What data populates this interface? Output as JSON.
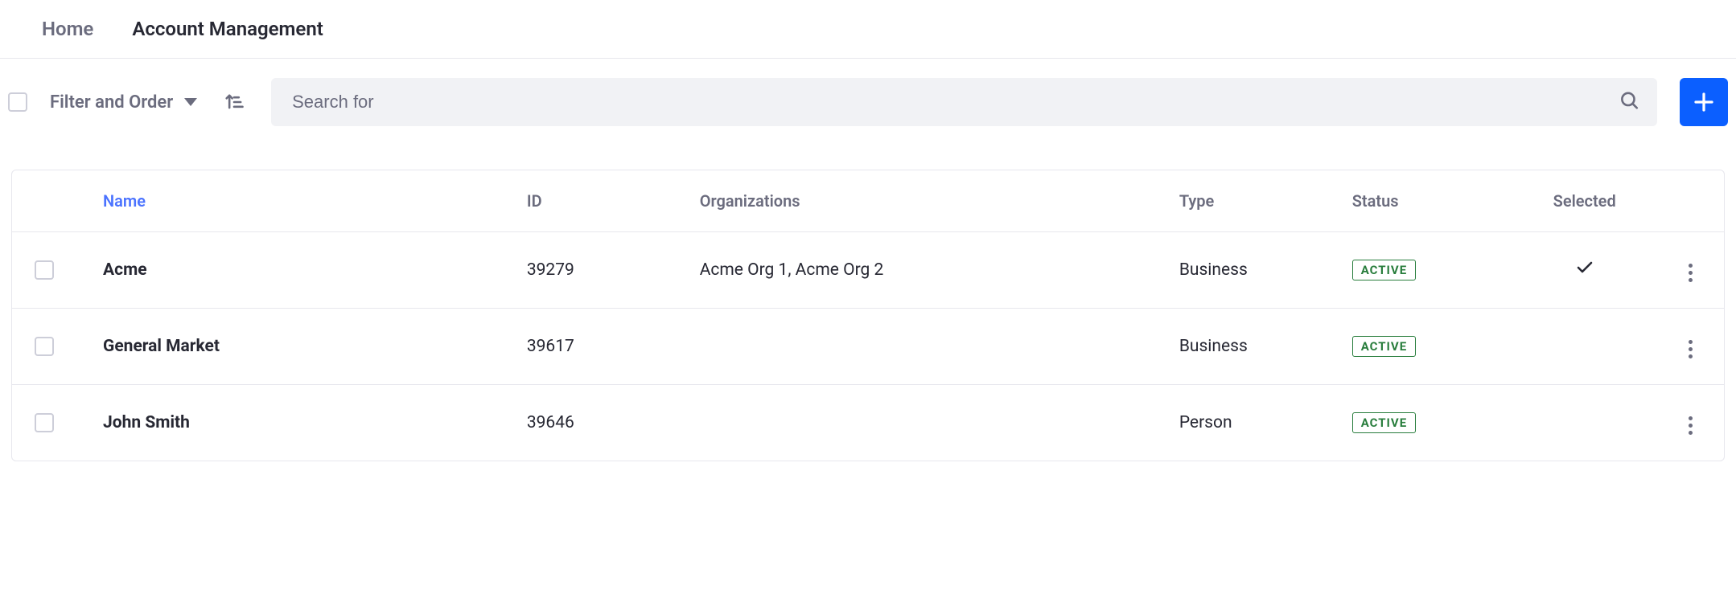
{
  "nav": {
    "home": "Home",
    "current": "Account Management"
  },
  "toolbar": {
    "filter_label": "Filter and Order",
    "search_placeholder": "Search for"
  },
  "table": {
    "headers": {
      "name": "Name",
      "id": "ID",
      "orgs": "Organizations",
      "type": "Type",
      "status": "Status",
      "selected": "Selected"
    },
    "rows": [
      {
        "name": "Acme",
        "id": "39279",
        "orgs": "Acme Org 1, Acme Org 2",
        "type": "Business",
        "status": "ACTIVE",
        "selected": true
      },
      {
        "name": "General Market",
        "id": "39617",
        "orgs": "",
        "type": "Business",
        "status": "ACTIVE",
        "selected": false
      },
      {
        "name": "John Smith",
        "id": "39646",
        "orgs": "",
        "type": "Person",
        "status": "ACTIVE",
        "selected": false
      }
    ]
  }
}
